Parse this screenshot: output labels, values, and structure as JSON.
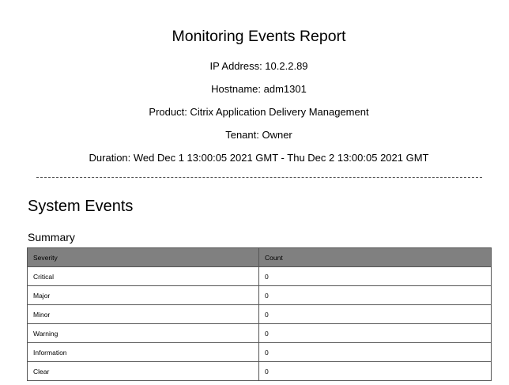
{
  "report": {
    "title": "Monitoring Events Report",
    "ip_address": "IP Address: 10.2.2.89",
    "hostname": "Hostname: adm1301",
    "product": "Product: Citrix Application Delivery Management",
    "tenant": "Tenant: Owner",
    "duration": "Duration: Wed Dec 1 13:00:05 2021 GMT - Thu Dec 2 13:00:05 2021 GMT"
  },
  "section": {
    "title": "System Events",
    "summary_title": "Summary"
  },
  "summary_table": {
    "headers": [
      "Severity",
      "Count"
    ],
    "rows": [
      {
        "severity": "Critical",
        "count": "0"
      },
      {
        "severity": "Major",
        "count": "0"
      },
      {
        "severity": "Minor",
        "count": "0"
      },
      {
        "severity": "Warning",
        "count": "0"
      },
      {
        "severity": "Information",
        "count": "0"
      },
      {
        "severity": "Clear",
        "count": "0"
      }
    ]
  },
  "colors": {
    "header_background": "#808080",
    "border": "#555555"
  }
}
